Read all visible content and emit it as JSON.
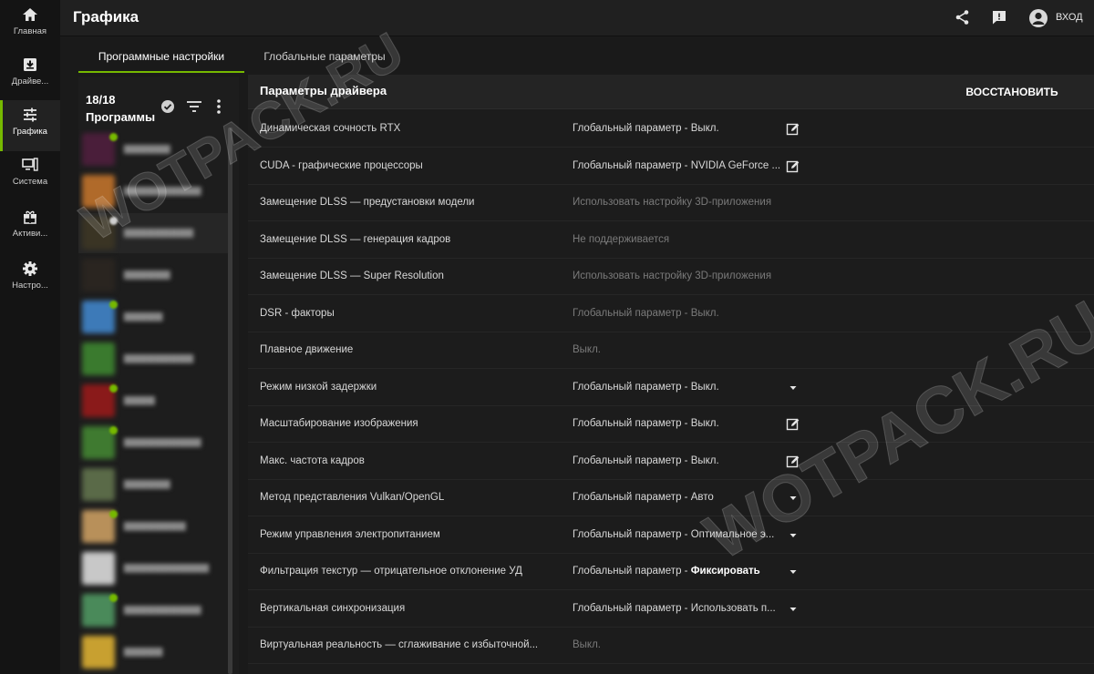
{
  "nav": {
    "items": [
      {
        "label": "Главная",
        "icon": "home-icon"
      },
      {
        "label": "Драйве...",
        "icon": "download-icon"
      },
      {
        "label": "Графика",
        "icon": "sliders-icon",
        "active": true
      },
      {
        "label": "Система",
        "icon": "monitor-icon"
      },
      {
        "label": "Активи...",
        "icon": "gift-icon"
      },
      {
        "label": "Настро...",
        "icon": "gear-icon"
      }
    ]
  },
  "header": {
    "title": "Графика",
    "login_label": "ВХОД"
  },
  "tabs": [
    {
      "label": "Программные настройки",
      "active": true
    },
    {
      "label": "Глобальные параметры",
      "active": false
    }
  ],
  "programs": {
    "count": "18/18",
    "label": "Программы"
  },
  "settings": {
    "title": "Параметры драйвера",
    "restore_label": "ВОССТАНОВИТЬ",
    "rows": [
      {
        "name": "Динамическая сочность RTX",
        "prefix": "Глобальный параметр - Выкл.",
        "strong": "",
        "control": "edit",
        "dim": false
      },
      {
        "name": "CUDA - графические процессоры",
        "prefix": "Глобальный параметр - NVIDIA GeForce ...",
        "strong": "",
        "control": "edit",
        "dim": false
      },
      {
        "name": "Замещение DLSS — предустановки модели",
        "prefix": "Использовать настройку 3D-приложения",
        "strong": "",
        "control": "none",
        "dim": true
      },
      {
        "name": "Замещение DLSS — генерация кадров",
        "prefix": "Не поддерживается",
        "strong": "",
        "control": "none",
        "dim": true
      },
      {
        "name": "Замещение DLSS — Super Resolution",
        "prefix": "Использовать настройку 3D-приложения",
        "strong": "",
        "control": "none",
        "dim": true
      },
      {
        "name": "DSR - факторы",
        "prefix": "Глобальный параметр - Выкл.",
        "strong": "",
        "control": "none",
        "dim": true
      },
      {
        "name": "Плавное движение",
        "prefix": "Выкл.",
        "strong": "",
        "control": "none",
        "dim": true
      },
      {
        "name": "Режим низкой задержки",
        "prefix": "Глобальный параметр - Выкл.",
        "strong": "",
        "control": "dropdown",
        "dim": false
      },
      {
        "name": "Масштабирование изображения",
        "prefix": "Глобальный параметр - Выкл.",
        "strong": "",
        "control": "edit",
        "dim": false
      },
      {
        "name": "Макс. частота кадров",
        "prefix": "Глобальный параметр - Выкл.",
        "strong": "",
        "control": "edit",
        "dim": false
      },
      {
        "name": "Метод представления Vulkan/OpenGL",
        "prefix": "Глобальный параметр - Авто",
        "strong": "",
        "control": "dropdown",
        "dim": false
      },
      {
        "name": "Режим управления электропитанием",
        "prefix": "Глобальный параметр - Оптимальное э...",
        "strong": "",
        "control": "dropdown",
        "dim": false
      },
      {
        "name": "Фильтрация текстур — отрицательное отклонение УД",
        "prefix": "Глобальный параметр - ",
        "strong": "Фиксировать",
        "control": "dropdown",
        "dim": false
      },
      {
        "name": "Вертикальная синхронизация",
        "prefix": "Глобальный параметр - Использовать п...",
        "strong": "",
        "control": "dropdown",
        "dim": false
      },
      {
        "name": "Виртуальная реальность — сглаживание с избыточной...",
        "prefix": "Выкл.",
        "strong": "",
        "control": "none",
        "dim": true
      }
    ]
  },
  "watermark": "WOTPACK.RU",
  "colors": {
    "accent": "#76b900",
    "background": "#1a1a1a",
    "panel": "#1c1c1c"
  }
}
